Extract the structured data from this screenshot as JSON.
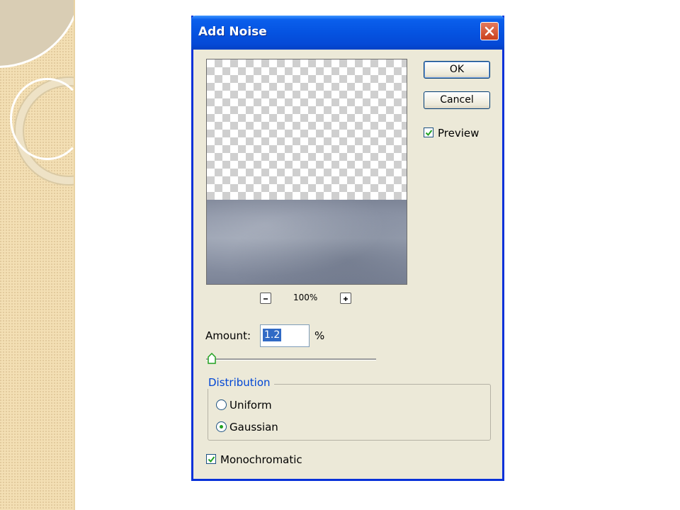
{
  "dialog": {
    "title": "Add Noise",
    "ok_label": "OK",
    "cancel_label": "Cancel",
    "preview_label": "Preview",
    "preview_checked": true,
    "zoom_level": "100%",
    "amount_label": "Amount:",
    "amount_value": "1.2",
    "amount_unit": "%",
    "distribution": {
      "legend": "Distribution",
      "options": [
        {
          "label": "Uniform",
          "selected": false
        },
        {
          "label": "Gaussian",
          "selected": true
        }
      ]
    },
    "monochromatic_label": "Monochromatic",
    "monochromatic_checked": true
  },
  "colors": {
    "titlebar": "#0553e1",
    "dialog_bg": "#ece9d8",
    "check_green": "#21a121",
    "legend_blue": "#0046d5"
  },
  "icons": [
    "close-icon",
    "zoom-out-icon",
    "zoom-in-icon",
    "checkmark-icon",
    "slider-thumb-icon"
  ]
}
